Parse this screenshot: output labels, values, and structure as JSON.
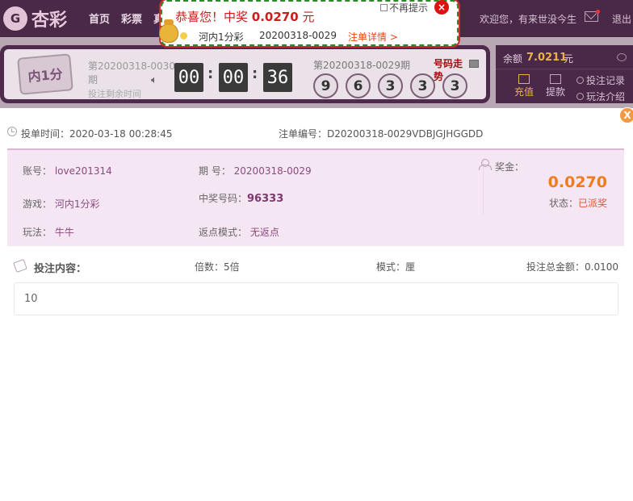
{
  "header": {
    "logo_mark": "G",
    "logo_text": "杏彩",
    "nav": [
      "首页",
      "彩票",
      "真"
    ],
    "welcome": "欢迎您，有来世没今生",
    "exit_label": "退出"
  },
  "lottery_bar": {
    "logo_label": "内1分",
    "current_issue": "第20200318-0030期",
    "countdown_label": "投注剩余时间",
    "mute_icon": "speaker-mute",
    "countdown": {
      "h": "00",
      "m": "00",
      "s": "36"
    },
    "prev_issue": "第20200318-0029期",
    "trend_label": "号码走势",
    "draw_numbers": [
      "9",
      "6",
      "3",
      "3",
      "3"
    ]
  },
  "account": {
    "balance_label": "余额",
    "balance": "7.0211",
    "balance_unit": "元",
    "recharge": "充值",
    "withdraw": "提款",
    "bet_records": "投注记录",
    "play_intro": "玩法介绍"
  },
  "win_popup": {
    "title_prefix": "恭喜您！中奖 ",
    "amount": "0.0270",
    "title_suffix": " 元",
    "no_remind": "不再提示",
    "close": "×",
    "lottery": "河内1分彩",
    "issue": "20200318-0029",
    "detail_link": "注单详情 >"
  },
  "detail": {
    "close": "X",
    "bet_time_label": "投单时间：",
    "bet_time": "2020-03-18 00:28:45",
    "order_no_label": "注单编号：",
    "order_no": "D20200318-0029VDBJGJHGGDD",
    "account_label": "账号：",
    "account": "love201314",
    "issue_label": "期 号：",
    "issue": "20200318-0029",
    "game_label": "游戏：",
    "game": "河内1分彩",
    "win_code_label": "中奖号码：",
    "win_code": "96333",
    "play_label": "玩法：",
    "play": "牛牛",
    "rebate_label": "返点模式：",
    "rebate": "无返点",
    "prize_label": "奖金：",
    "prize": "0.0270",
    "status_label": "状态：",
    "status": "已派奖",
    "bet_content_label": "投注内容：",
    "multiplier_label": "倍数：",
    "multiplier": "5倍",
    "mode_label": "模式：",
    "mode": "厘",
    "total_label": "投注总金额：",
    "total": "0.0100",
    "bet_content": "10"
  },
  "colors": {
    "header_bg": "#4a2848",
    "accent_orange": "#f07c20",
    "status_red": "#e2553a",
    "info_bg": "#f5e6f3"
  }
}
